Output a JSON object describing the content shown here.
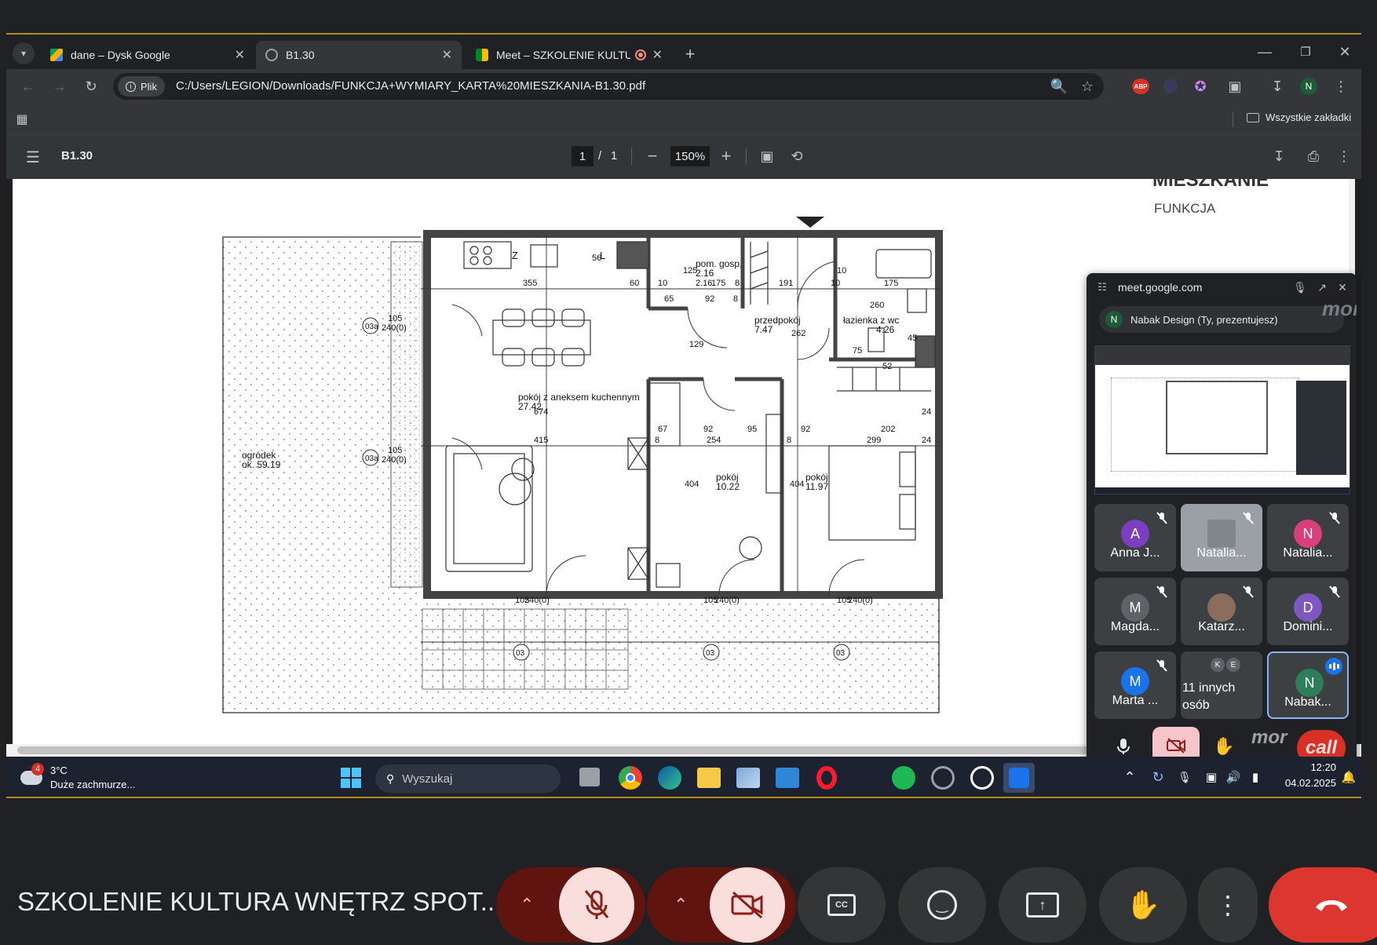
{
  "browser": {
    "tabs": [
      {
        "title": "dane – Dysk Google",
        "favicon": "google-drive-icon",
        "active": false
      },
      {
        "title": "B1.30",
        "favicon": "globe-icon",
        "active": true
      },
      {
        "title": "Meet – SZKOLENIE KULTUR",
        "favicon": "google-meet-icon",
        "active": false
      }
    ],
    "security_chip": "Plik",
    "url": "C:/Users/LEGION/Downloads/FUNKCJA+WYMIARY_KARTA%20MIESZKANIA-B1.30.pdf",
    "all_bookmarks": "Wszystkie zakładki",
    "profile_initial": "N",
    "abp_label": "ABP"
  },
  "pdf": {
    "doc_title": "B1.30",
    "page_current": "1",
    "page_sep": "/",
    "page_total": "1",
    "zoom": "150%",
    "header_title": "MIESZKANIE",
    "header_subtitle": "FUNKCJA"
  },
  "plan": {
    "rooms": [
      {
        "name": "pom. gosp.",
        "area": "2.16"
      },
      {
        "name": "przedpokój",
        "area": "7.47"
      },
      {
        "name": "łazienka z wc",
        "area": "4.26"
      },
      {
        "name": "pokój z aneksem kuchennym",
        "area": "27.42"
      },
      {
        "name": "pokój",
        "area": "10.22"
      },
      {
        "name": "pokój",
        "area": "11.97"
      },
      {
        "name": "ogródek",
        "area": "ok. 59.19"
      }
    ],
    "dims": [
      "355",
      "60",
      "10",
      "175",
      "8",
      "191",
      "10",
      "175",
      "65",
      "92",
      "8",
      "129",
      "262",
      "260",
      "75",
      "52",
      "45",
      "67",
      "92",
      "95",
      "92",
      "202",
      "8",
      "254",
      "8",
      "299",
      "24",
      "415",
      "674",
      "404",
      "404",
      "24",
      "125",
      "2.16",
      "56",
      "10",
      "240(0)",
      "105",
      "240(0)",
      "105",
      "240(0)",
      "105",
      "240(0)",
      "105",
      "240(0)",
      "105"
    ],
    "window_tags": [
      "03a",
      "03a",
      "03",
      "03",
      "03"
    ],
    "kitchen_letter": "Z",
    "lodowka": "L"
  },
  "meet_pip": {
    "domain": "meet.google.com",
    "presenting": "Nabak Design (Ty, prezentujesz)",
    "presenter_initial": "N",
    "watermark": "mor",
    "participants": [
      {
        "name": "Anna J...",
        "initial": "A",
        "color": "#7b3fbf",
        "muted": true
      },
      {
        "name": "Natalia...",
        "initial": "",
        "color": "#9aa0a6",
        "muted": true,
        "photo": true
      },
      {
        "name": "Natalia...",
        "initial": "N",
        "color": "#d93f7b",
        "muted": true
      },
      {
        "name": "Magda...",
        "initial": "M",
        "color": "#5f6368",
        "muted": true
      },
      {
        "name": "Katarz...",
        "initial": "",
        "color": "#8a6d5a",
        "muted": true,
        "photo": true
      },
      {
        "name": "Domini...",
        "initial": "D",
        "color": "#7e57c2",
        "muted": true
      },
      {
        "name": "Marta ...",
        "initial": "M",
        "color": "#1a73e8",
        "muted": true
      },
      {
        "name": "11 innych osób",
        "initials": [
          "K",
          "E"
        ],
        "others": true
      },
      {
        "name": "Nabak...",
        "initial": "N",
        "color": "#2e7d5b",
        "speaking": true
      }
    ],
    "call_text": "call"
  },
  "taskbar": {
    "weather_temp": "3°C",
    "weather_desc": "Duże zachmurze...",
    "weather_badge": "4",
    "search_placeholder": "Wyszukaj",
    "time": "12:20",
    "date": "04.02.2025"
  },
  "meeting": {
    "title": "SZKOLENIE KULTURA WNĘTRZ SPOT..."
  }
}
